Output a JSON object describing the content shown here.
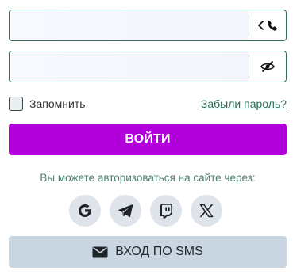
{
  "phone_field": {
    "value": "",
    "placeholder": "",
    "action_icon": "chevron-phone-icon"
  },
  "password_field": {
    "value": "",
    "placeholder": "",
    "action_icon": "eye-slash-icon"
  },
  "remember": {
    "label": "Запомнить",
    "checked": false
  },
  "forgot_link": "Забыли пароль?",
  "login_button": "ВОЙТИ",
  "social": {
    "caption": "Вы можете авторизоваться на сайте через:",
    "providers": [
      "google-icon",
      "telegram-icon",
      "twitch-icon",
      "x-icon"
    ]
  },
  "sms_button": {
    "label": "ВХОД ПО SMS",
    "icon": "envelope-icon"
  },
  "colors": {
    "accent": "#b100d9",
    "field_border": "#2f6b55",
    "link": "#2d6f5c",
    "social_bg": "#dfe4ea",
    "sms_bg": "#c9d5e1"
  }
}
